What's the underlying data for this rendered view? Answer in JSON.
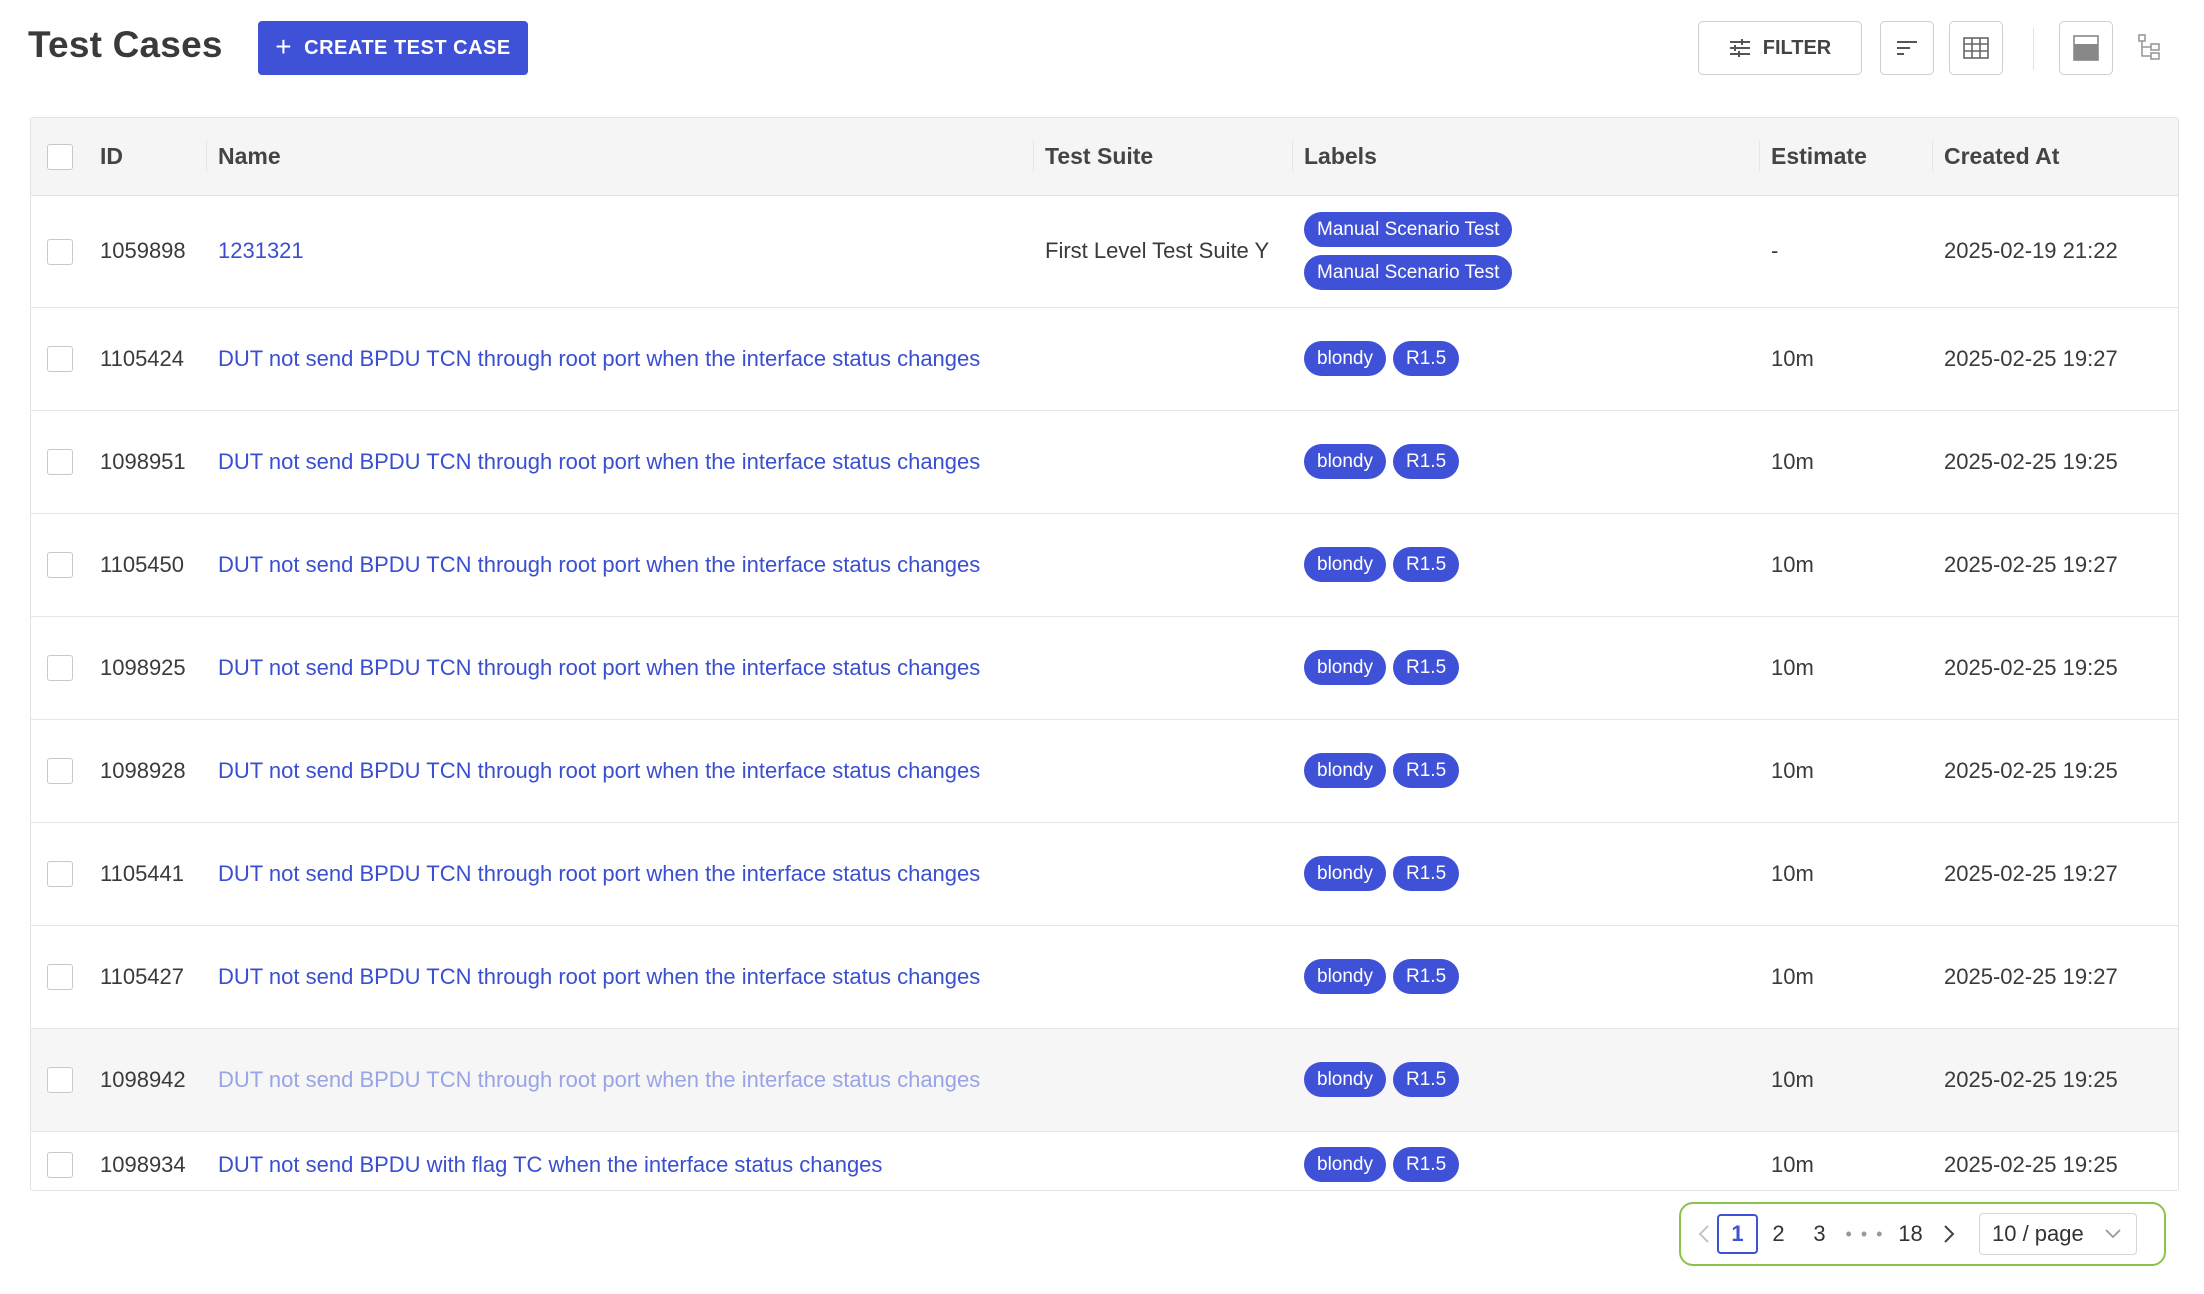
{
  "header": {
    "title": "Test Cases",
    "create_label": "CREATE TEST CASE",
    "filter_label": "FILTER",
    "icons": [
      "plus-icon",
      "filter-sliders-icon",
      "sort-icon",
      "column-grid-icon",
      "row-density-icon",
      "tree-view-icon"
    ]
  },
  "table": {
    "columns": [
      "ID",
      "Name",
      "Test Suite",
      "Labels",
      "Estimate",
      "Created At"
    ],
    "rows": [
      {
        "id": "1059898",
        "name": "1231321",
        "suite": "First Level Test Suite Y",
        "labels": [
          "Manual Scenario Test",
          "Manual Scenario Test"
        ],
        "estimate": "-",
        "created": "2025-02-19 21:22"
      },
      {
        "id": "1105424",
        "name": "DUT not send BPDU TCN through root port when the interface status changes",
        "suite": "",
        "labels": [
          "blondy",
          "R1.5"
        ],
        "estimate": "10m",
        "created": "2025-02-25 19:27"
      },
      {
        "id": "1098951",
        "name": "DUT not send BPDU TCN through root port when the interface status changes",
        "suite": "",
        "labels": [
          "blondy",
          "R1.5"
        ],
        "estimate": "10m",
        "created": "2025-02-25 19:25"
      },
      {
        "id": "1105450",
        "name": "DUT not send BPDU TCN through root port when the interface status changes",
        "suite": "",
        "labels": [
          "blondy",
          "R1.5"
        ],
        "estimate": "10m",
        "created": "2025-02-25 19:27"
      },
      {
        "id": "1098925",
        "name": "DUT not send BPDU TCN through root port when the interface status changes",
        "suite": "",
        "labels": [
          "blondy",
          "R1.5"
        ],
        "estimate": "10m",
        "created": "2025-02-25 19:25"
      },
      {
        "id": "1098928",
        "name": "DUT not send BPDU TCN through root port when the interface status changes",
        "suite": "",
        "labels": [
          "blondy",
          "R1.5"
        ],
        "estimate": "10m",
        "created": "2025-02-25 19:25"
      },
      {
        "id": "1105441",
        "name": "DUT not send BPDU TCN through root port when the interface status changes",
        "suite": "",
        "labels": [
          "blondy",
          "R1.5"
        ],
        "estimate": "10m",
        "created": "2025-02-25 19:27"
      },
      {
        "id": "1105427",
        "name": "DUT not send BPDU TCN through root port when the interface status changes",
        "suite": "",
        "labels": [
          "blondy",
          "R1.5"
        ],
        "estimate": "10m",
        "created": "2025-02-25 19:27"
      },
      {
        "id": "1098942",
        "name": "DUT not send BPDU TCN through root port when the interface status changes",
        "suite": "",
        "labels": [
          "blondy",
          "R1.5"
        ],
        "estimate": "10m",
        "created": "2025-02-25 19:25"
      },
      {
        "id": "1098934",
        "name": "DUT not send BPDU with flag TC when the interface status changes",
        "suite": "",
        "labels": [
          "blondy",
          "R1.5"
        ],
        "estimate": "10m",
        "created": "2025-02-25 19:25"
      }
    ]
  },
  "pagination": {
    "pages": [
      "1",
      "2",
      "3"
    ],
    "current": "1",
    "ellipsis": "• • •",
    "last": "18",
    "page_size": "10 / page"
  },
  "colors": {
    "accent": "#3f51d6",
    "link": "#3a4fd0",
    "pager_highlight": "#8bc34a"
  }
}
